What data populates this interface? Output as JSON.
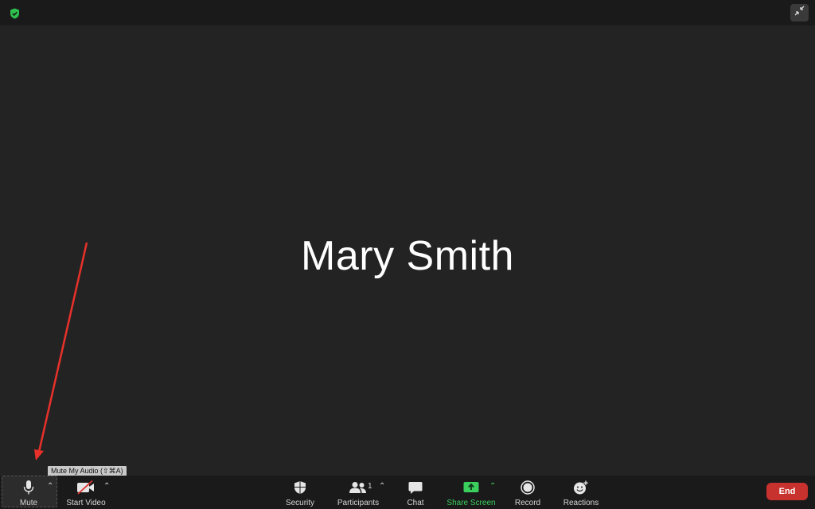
{
  "meeting": {
    "participant_name": "Mary Smith"
  },
  "tooltip": {
    "text": "Mute My Audio (⇧⌘A)"
  },
  "toolbar": {
    "mute_label": "Mute",
    "start_video_label": "Start Video",
    "security_label": "Security",
    "participants_label": "Participants",
    "participants_count": "1",
    "chat_label": "Chat",
    "share_screen_label": "Share Screen",
    "record_label": "Record",
    "reactions_label": "Reactions",
    "end_label": "End"
  },
  "colors": {
    "background": "#232323",
    "toolbar": "#1a1a1a",
    "share_green": "#3bcf5d",
    "end_red": "#c7312e",
    "annotation_red": "#e8312a"
  },
  "icons": {
    "top_left": "shield-check-icon",
    "top_right": "exit-fullscreen-icon",
    "mute": "microphone-icon",
    "video": "video-off-icon",
    "security": "shield-icon",
    "participants": "participants-icon",
    "chat": "chat-bubble-icon",
    "share": "share-screen-icon",
    "record": "record-icon",
    "reactions": "emoji-add-icon"
  }
}
